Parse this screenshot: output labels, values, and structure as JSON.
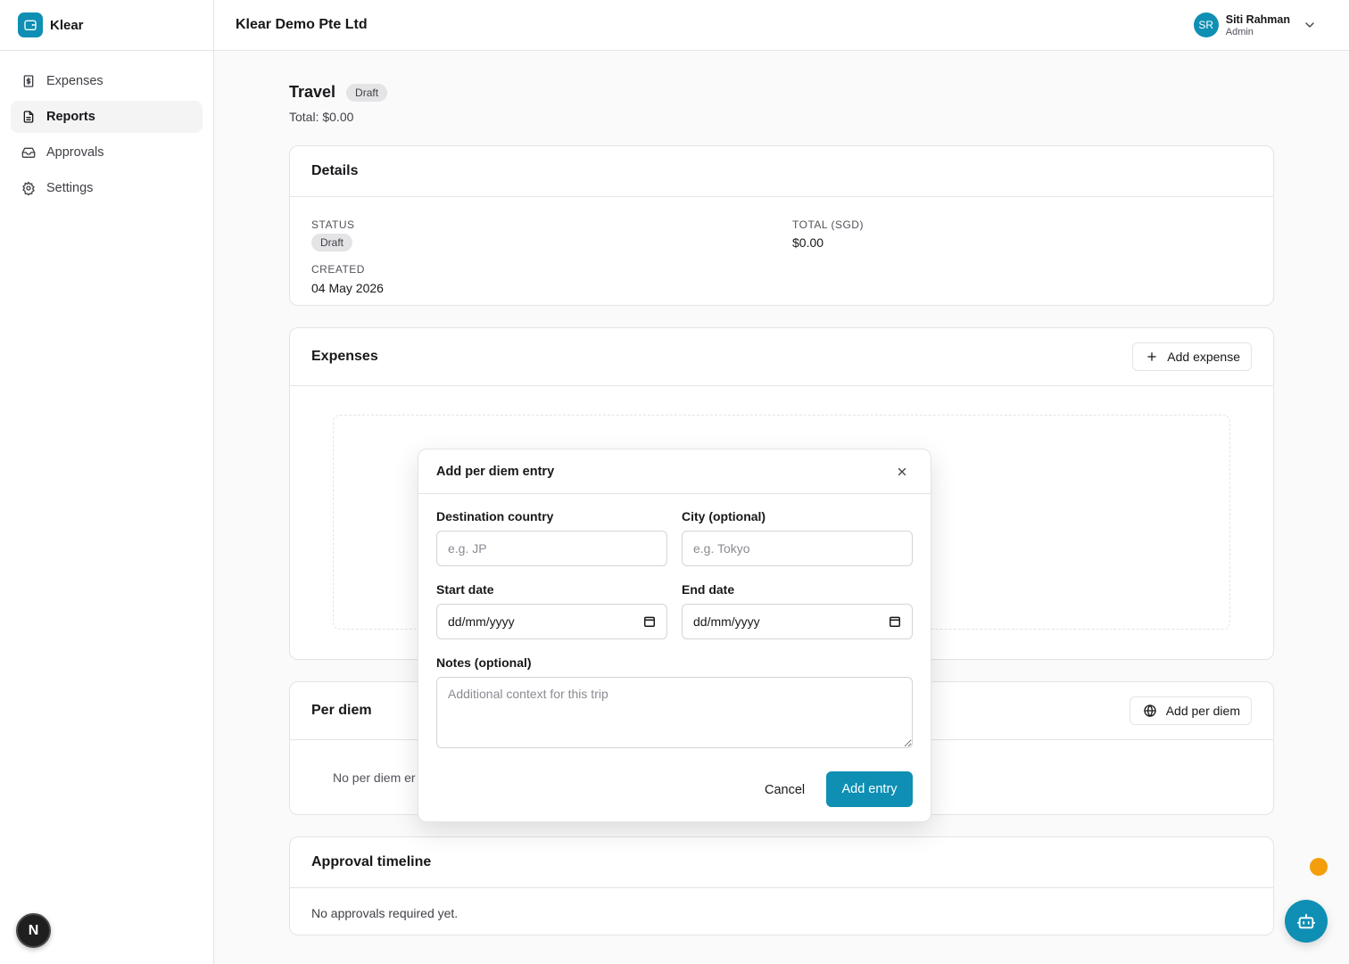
{
  "app": {
    "name": "Klear"
  },
  "sidebar": {
    "items": [
      {
        "label": "Expenses",
        "icon": "receipt-icon"
      },
      {
        "label": "Reports",
        "icon": "file-text-icon",
        "active": true
      },
      {
        "label": "Approvals",
        "icon": "inbox-icon"
      },
      {
        "label": "Settings",
        "icon": "gear-icon"
      }
    ],
    "dev_badge": "N"
  },
  "header": {
    "org": "Klear Demo Pte Ltd",
    "user": {
      "initials": "SR",
      "name": "Siti Rahman",
      "role": "Admin"
    }
  },
  "report": {
    "title": "Travel",
    "status": "Draft",
    "total_line": "Total: $0.00"
  },
  "details": {
    "title": "Details",
    "status_label": "STATUS",
    "status_value": "Draft",
    "created_label": "CREATED",
    "created_value": "04 May 2026",
    "total_label": "TOTAL (SGD)",
    "total_value": "$0.00"
  },
  "expenses": {
    "title": "Expenses",
    "add_label": "Add expense"
  },
  "per_diem": {
    "title": "Per diem",
    "add_label": "Add per diem",
    "empty": "No per diem er"
  },
  "timeline": {
    "title": "Approval timeline",
    "empty": "No approvals required yet."
  },
  "modal": {
    "title": "Add per diem entry",
    "country_label": "Destination country",
    "country_placeholder": "e.g. JP",
    "city_label": "City (optional)",
    "city_placeholder": "e.g. Tokyo",
    "start_label": "Start date",
    "start_value": "dd/mm/yyyy",
    "end_label": "End date",
    "end_value": "dd/mm/yyyy",
    "notes_label": "Notes (optional)",
    "notes_placeholder": "Additional context for this trip",
    "cancel": "Cancel",
    "submit": "Add entry"
  },
  "colors": {
    "accent": "#0e8fb3",
    "notification": "#f59e0b"
  }
}
